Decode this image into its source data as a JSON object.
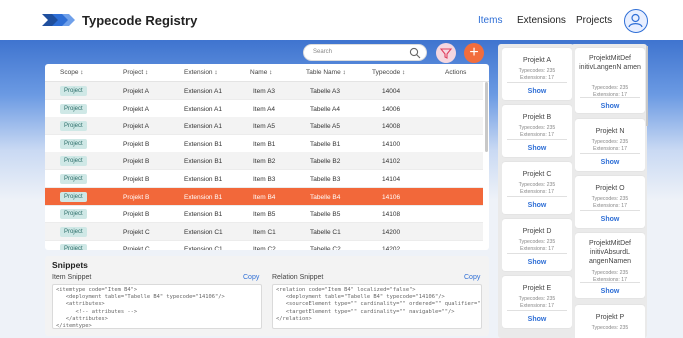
{
  "header": {
    "title": "Typecode Registry",
    "nav": [
      {
        "label": "Items",
        "active": true
      },
      {
        "label": "Extensions",
        "active": false
      },
      {
        "label": "Projects",
        "active": false
      }
    ]
  },
  "search": {
    "placeholder": "Search"
  },
  "table": {
    "columns": [
      {
        "label": "Scope ↕"
      },
      {
        "label": "Project ↕"
      },
      {
        "label": "Extension ↕"
      },
      {
        "label": "Name ↕"
      },
      {
        "label": "Table Name ↕"
      },
      {
        "label": "Typecode ↕"
      },
      {
        "label": "Actions"
      }
    ],
    "rows": [
      {
        "scope": "Project",
        "project": "Projekt A",
        "extension": "Extension A1",
        "name": "Item A3",
        "table": "Tabelle A3",
        "typecode": "14004"
      },
      {
        "scope": "Project",
        "project": "Projekt A",
        "extension": "Extension A1",
        "name": "Item A4",
        "table": "Tabelle A4",
        "typecode": "14006"
      },
      {
        "scope": "Project",
        "project": "Projekt A",
        "extension": "Extension A1",
        "name": "Item A5",
        "table": "Tabelle A5",
        "typecode": "14008"
      },
      {
        "scope": "Project",
        "project": "Projekt B",
        "extension": "Extension B1",
        "name": "Item B1",
        "table": "Tabelle B1",
        "typecode": "14100"
      },
      {
        "scope": "Project",
        "project": "Projekt B",
        "extension": "Extension B1",
        "name": "Item B2",
        "table": "Tabelle B2",
        "typecode": "14102"
      },
      {
        "scope": "Project",
        "project": "Projekt B",
        "extension": "Extension B1",
        "name": "Item B3",
        "table": "Tabelle B3",
        "typecode": "14104"
      },
      {
        "scope": "Project",
        "project": "Projekt B",
        "extension": "Extension B1",
        "name": "Item B4",
        "table": "Tabelle B4",
        "typecode": "14106"
      },
      {
        "scope": "Project",
        "project": "Projekt B",
        "extension": "Extension B1",
        "name": "Item B5",
        "table": "Tabelle B5",
        "typecode": "14108"
      },
      {
        "scope": "Project",
        "project": "Projekt C",
        "extension": "Extension C1",
        "name": "Item C1",
        "table": "Tabelle C1",
        "typecode": "14200"
      },
      {
        "scope": "Project",
        "project": "Projekt C",
        "extension": "Extension C1",
        "name": "Item C2",
        "table": "Tabelle C2",
        "typecode": "14202"
      }
    ],
    "selected_index": 6
  },
  "snippets": {
    "title": "Snippets",
    "item": {
      "label": "Item Snippet",
      "copy_label": "Copy",
      "code": "<itemtype code=\"Item B4\">\n   <deployment table=\"Tabelle B4\" typecode=\"14106\"/>\n   <attributes>\n      <!-- attributes -->\n   </attributes>\n</itemtype>"
    },
    "relation": {
      "label": "Relation Snippet",
      "copy_label": "Copy",
      "code": "<relation code=\"Item B4\" localized=\"false\">\n   <deployment table=\"Tabelle B4\" typecode=\"14106\"/>\n   <sourceElement type=\"\" cardinality=\"\" ordered=\"\" qualifier=\"\"/>\n   <targetElement type=\"\" cardinality=\"\" navigable=\"\"/>\n</relation>"
    }
  },
  "projects": {
    "col1": [
      {
        "name": "Projekt A",
        "types": "Typecodes: 235",
        "ext": "Extensions: 17",
        "show": "Show"
      },
      {
        "name": "Projekt B",
        "types": "Typecodes: 235",
        "ext": "Extensions: 17",
        "show": "Show"
      },
      {
        "name": "Projekt C",
        "types": "Typecodes: 235",
        "ext": "Extensions: 17",
        "show": "Show"
      },
      {
        "name": "Projekt D",
        "types": "Typecodes: 235",
        "ext": "Extensions: 17",
        "show": "Show"
      },
      {
        "name": "Projekt E",
        "types": "Typecodes: 235",
        "ext": "Extensions: 17",
        "show": "Show"
      }
    ],
    "col2": [
      {
        "name": "ProjektMitDef initivLangenN amen",
        "types": "Typecodes: 235",
        "ext": "Extensions: 17",
        "show": "Show"
      },
      {
        "name": "Projekt N",
        "types": "Typecodes: 235",
        "ext": "Extensions: 17",
        "show": "Show"
      },
      {
        "name": "Projekt O",
        "types": "Typecodes: 235",
        "ext": "Extensions: 17",
        "show": "Show"
      },
      {
        "name": "ProjektMitDef initivAbsurdL angenNamen",
        "types": "Typecodes: 235",
        "ext": "Extensions: 17",
        "show": "Show"
      },
      {
        "name": "Projekt P",
        "types": "Typecodes: 235",
        "ext": "",
        "show": ""
      }
    ]
  },
  "colors": {
    "accent": "#2f6fd6",
    "selected_row": "#f2683a",
    "add_button": "#f26d3d",
    "badge_bg": "#cfe8e6"
  }
}
